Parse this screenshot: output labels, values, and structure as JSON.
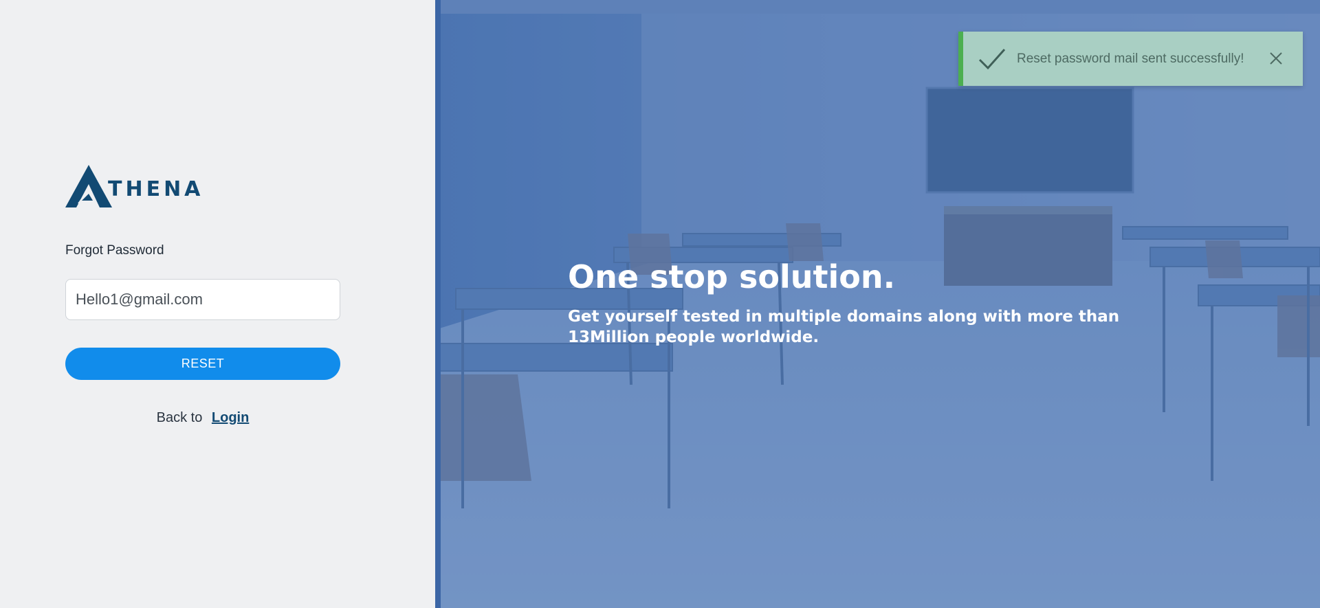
{
  "brand": {
    "logo_text": "THENA",
    "logo_icon": "athena-a-logo-icon",
    "primary_color": "#124a73"
  },
  "form": {
    "title": "Forgot Password",
    "email_value": "Hello1@gmail.com",
    "reset_label": "RESET",
    "back_prefix": "Back to",
    "login_label": "Login",
    "button_color": "#118ceb"
  },
  "hero": {
    "title": "One stop solution.",
    "subtitle": "Get yourself tested in multiple domains along with more than 13Million people worldwide."
  },
  "toast": {
    "message": "Reset password mail sent successfully!",
    "icon": "checkmark-icon",
    "close_icon": "close-icon",
    "accent_color": "#4caf50"
  }
}
